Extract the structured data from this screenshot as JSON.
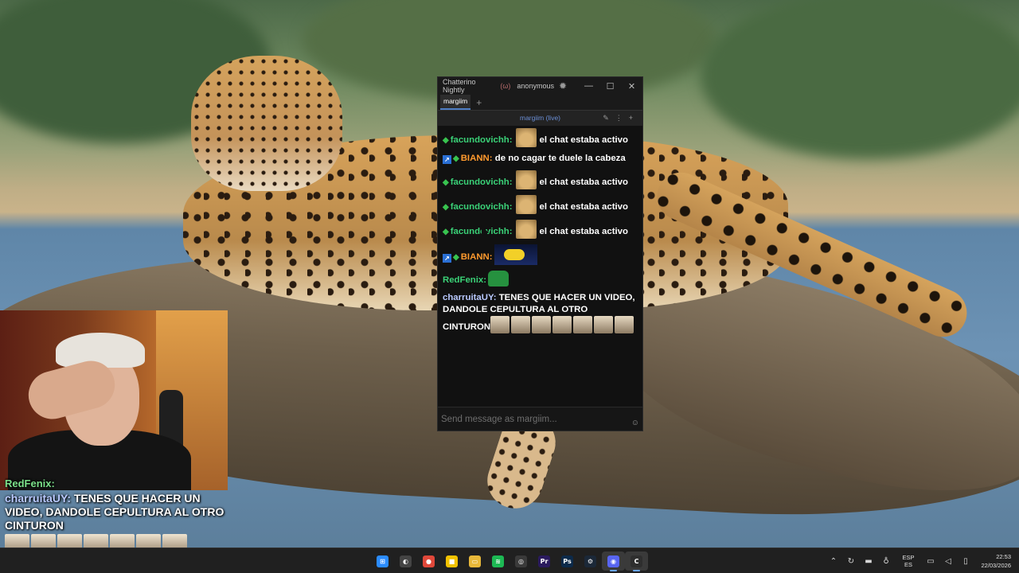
{
  "window": {
    "app_title": "Chatterino Nightly",
    "live_indicator": "(ω)",
    "account": "anonymous",
    "minimize": "—",
    "maximize": "☐",
    "close": "✕"
  },
  "tabs": [
    {
      "label": "margiim"
    }
  ],
  "split": {
    "channel_label": "margiim (live)"
  },
  "messages": [
    {
      "badges": [
        "star"
      ],
      "user": "facundovichh:",
      "user_color": "#3ad177",
      "emote": "cheems",
      "text": "el chat estaba activo"
    },
    {
      "badges": [
        "box",
        "star"
      ],
      "user": "BIANN:",
      "user_color": "#ff9a2e",
      "text": "de no cagar te duele la cabeza"
    },
    {
      "badges": [
        "star"
      ],
      "user": "facundovichh:",
      "user_color": "#3ad177",
      "emote": "cheems",
      "text": "el chat estaba activo"
    },
    {
      "badges": [
        "star"
      ],
      "user": "facundovichh:",
      "user_color": "#3ad177",
      "emote": "cheems",
      "text": "el chat estaba activo"
    },
    {
      "badges": [
        "star"
      ],
      "user": "facundovichh:",
      "user_color": "#3ad177",
      "emote": "cheems",
      "text": "el chat estaba activo"
    },
    {
      "badges": [
        "box",
        "star"
      ],
      "user": "BIANN:",
      "user_color": "#ff9a2e",
      "emote": "minion",
      "text": ""
    },
    {
      "badges": [],
      "user": "RedFenix:",
      "user_color": "#3ad177",
      "emote": "frog",
      "text": ""
    },
    {
      "badges": [],
      "user": "charruitaUY:",
      "user_color": "#b9c9ff",
      "text": "TENES QUE HACER UN VIDEO, DANDOLE CEPULTURA AL OTRO CINTURON",
      "trailing_emotes": 7
    }
  ],
  "input": {
    "placeholder": "Send message as margiim..."
  },
  "overlay": {
    "prev_line": "RedFenix:",
    "user": "charruitaUY:",
    "text": "TENES QUE HACER UN VIDEO, DANDOLE CEPULTURA AL OTRO CINTURON",
    "emote_count": 7
  },
  "taskbar": {
    "apps": [
      {
        "name": "start",
        "glyph": "⊞",
        "color": "#2b8cff"
      },
      {
        "name": "task-manager",
        "glyph": "◐",
        "color": "#444"
      },
      {
        "name": "chrome",
        "glyph": "●",
        "color": "#e0483a"
      },
      {
        "name": "sticky-notes",
        "glyph": "■",
        "color": "#f2c200"
      },
      {
        "name": "file-explorer",
        "glyph": "▭",
        "color": "#e8b83a"
      },
      {
        "name": "spotify",
        "glyph": "≋",
        "color": "#1db954"
      },
      {
        "name": "obs",
        "glyph": "◎",
        "color": "#3a3a3a"
      },
      {
        "name": "premiere-pro",
        "glyph": "Pr",
        "color": "#2a1a5e"
      },
      {
        "name": "photoshop",
        "glyph": "Ps",
        "color": "#0c2a4a"
      },
      {
        "name": "steam",
        "glyph": "⚙",
        "color": "#1b2838"
      },
      {
        "name": "discord",
        "glyph": "◉",
        "color": "#5865f2",
        "active": true
      },
      {
        "name": "chatterino",
        "glyph": "C",
        "color": "#2e2e2e",
        "active": true
      }
    ],
    "tray": {
      "language_top": "ESP",
      "language_bottom": "ES",
      "time": "22:53",
      "date": "22/03/2026"
    }
  }
}
